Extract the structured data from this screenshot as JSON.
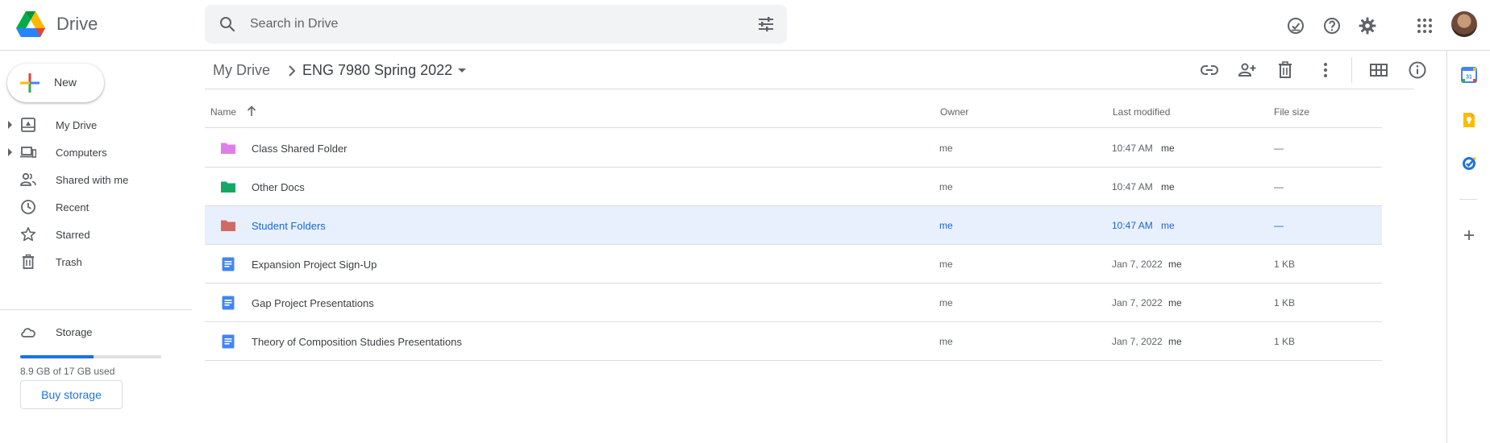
{
  "app": {
    "name": "Drive"
  },
  "search": {
    "placeholder": "Search in Drive"
  },
  "header_icons": [
    "ready-for-offline-icon",
    "help-icon",
    "settings-icon",
    "apps-grid-icon",
    "account-avatar"
  ],
  "sidebar": {
    "new_label": "New",
    "items": [
      {
        "label": "My Drive",
        "icon": "my-drive-icon",
        "expandable": true
      },
      {
        "label": "Computers",
        "icon": "computers-icon",
        "expandable": true
      },
      {
        "label": "Shared with me",
        "icon": "shared-icon",
        "expandable": false
      },
      {
        "label": "Recent",
        "icon": "clock-icon",
        "expandable": false
      },
      {
        "label": "Starred",
        "icon": "star-icon",
        "expandable": false
      },
      {
        "label": "Trash",
        "icon": "trash-icon",
        "expandable": false
      }
    ],
    "storage": {
      "label": "Storage",
      "used_text": "8.9 GB of 17 GB used",
      "used_fraction": 0.52,
      "buy_label": "Buy storage"
    }
  },
  "breadcrumb": {
    "root": "My Drive",
    "current": "ENG 7980 Spring 2022"
  },
  "table": {
    "headers": {
      "name": "Name",
      "owner": "Owner",
      "modified": "Last modified",
      "size": "File size"
    },
    "rows": [
      {
        "name": "Class Shared Folder",
        "type": "folder",
        "color": "#e07ee8",
        "owner": "me",
        "date": "10:47 AM",
        "modified_by": "me",
        "size": "—",
        "selected": false
      },
      {
        "name": "Other Docs",
        "type": "folder",
        "color": "#16a765",
        "owner": "me",
        "date": "10:47 AM",
        "modified_by": "me",
        "size": "—",
        "selected": false
      },
      {
        "name": "Student Folders",
        "type": "folder",
        "color": "#d06b64",
        "owner": "me",
        "date": "10:47 AM",
        "modified_by": "me",
        "size": "—",
        "selected": true
      },
      {
        "name": "Expansion Project Sign-Up",
        "type": "doc",
        "color": "#4285f4",
        "owner": "me",
        "date": "Jan 7, 2022",
        "modified_by": "me",
        "size": "1 KB",
        "selected": false
      },
      {
        "name": "Gap Project Presentations",
        "type": "doc",
        "color": "#4285f4",
        "owner": "me",
        "date": "Jan 7, 2022",
        "modified_by": "me",
        "size": "1 KB",
        "selected": false
      },
      {
        "name": "Theory of Composition Studies Presentations",
        "type": "doc",
        "color": "#4285f4",
        "owner": "me",
        "date": "Jan 7, 2022",
        "modified_by": "me",
        "size": "1 KB",
        "selected": false
      }
    ]
  },
  "colors": {
    "accent": "#1a73e8",
    "selected_bg": "#e8f0fe",
    "selected_text": "#1967d2"
  }
}
